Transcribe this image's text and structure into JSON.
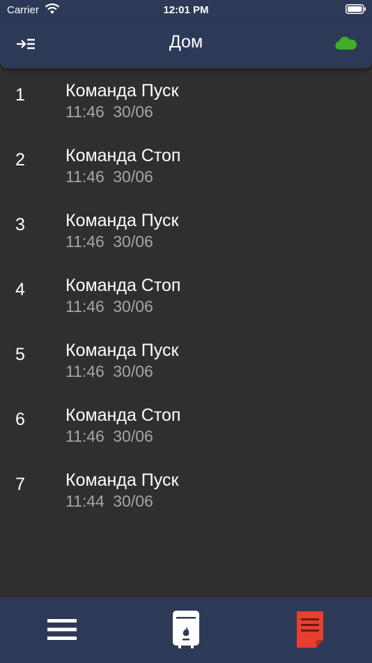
{
  "status_bar": {
    "carrier": "Carrier",
    "time": "12:01 PM"
  },
  "header": {
    "title": "Дом",
    "left_icon": "collapse-list-icon",
    "right_icon": "cloud-icon",
    "cloud_color": "#3fae2a"
  },
  "events": [
    {
      "index": "1",
      "title": "Команда Пуск",
      "time": "11:46",
      "date": "30/06"
    },
    {
      "index": "2",
      "title": "Команда Стоп",
      "time": "11:46",
      "date": "30/06"
    },
    {
      "index": "3",
      "title": "Команда Пуск",
      "time": "11:46",
      "date": "30/06"
    },
    {
      "index": "4",
      "title": "Команда Стоп",
      "time": "11:46",
      "date": "30/06"
    },
    {
      "index": "5",
      "title": "Команда Пуск",
      "time": "11:46",
      "date": "30/06"
    },
    {
      "index": "6",
      "title": "Команда Стоп",
      "time": "11:46",
      "date": "30/06"
    },
    {
      "index": "7",
      "title": "Команда Пуск",
      "time": "11:44",
      "date": "30/06"
    }
  ],
  "tab_bar": {
    "tabs": [
      {
        "icon": "hamburger-menu-icon"
      },
      {
        "icon": "boiler-icon"
      },
      {
        "icon": "log-document-icon",
        "color": "#e8402e"
      }
    ]
  },
  "colors": {
    "bar_background": "#2d3a57",
    "content_background": "#2f2f2f",
    "secondary_text": "#a6a6a6"
  }
}
